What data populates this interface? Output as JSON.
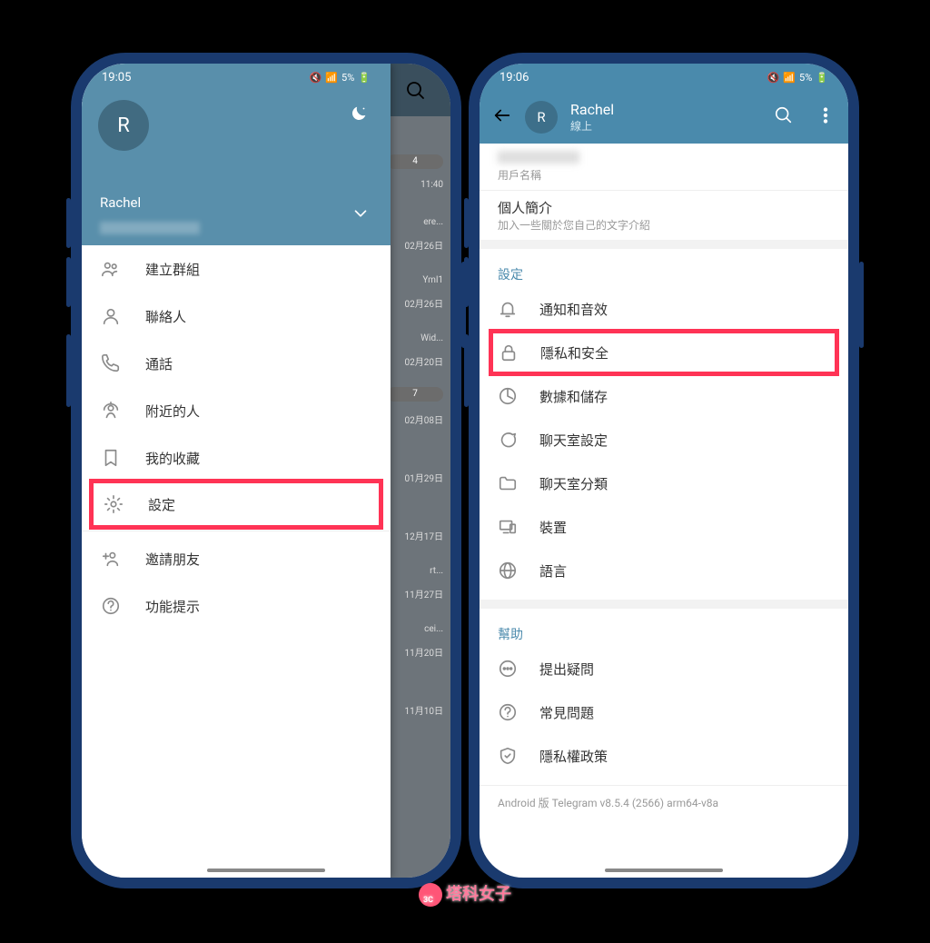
{
  "watermark": "塔科女子",
  "left": {
    "status_time": "19:05",
    "battery": "5%",
    "user_initial": "R",
    "user_name": "Rachel",
    "menu": {
      "new_group": "建立群組",
      "contacts": "聯絡人",
      "calls": "通話",
      "nearby": "附近的人",
      "saved": "我的收藏",
      "settings": "設定",
      "invite": "邀請朋友",
      "tips": "功能提示"
    },
    "chats": [
      {
        "badge": "4",
        "time": ""
      },
      {
        "time": "11:40",
        "text": "ere..."
      },
      {
        "time": "02月26日",
        "text": "Yml1"
      },
      {
        "time": "02月26日",
        "text": "Wid..."
      },
      {
        "time": "02月20日",
        "badge": "7"
      },
      {
        "time": "02月08日"
      },
      {
        "time": "01月29日"
      },
      {
        "time": "12月17日",
        "text": "rt..."
      },
      {
        "time": "11月27日",
        "text": "cei..."
      },
      {
        "time": "11月20日"
      },
      {
        "time": "11月10日"
      }
    ]
  },
  "right": {
    "status_time": "19:06",
    "battery": "5%",
    "user_initial": "R",
    "user_name": "Rachel",
    "user_status": "線上",
    "username_label": "用戶名稱",
    "bio_label": "個人簡介",
    "bio_hint": "加入一些關於您自己的文字介紹",
    "section_settings": "設定",
    "items": {
      "notifications": "通知和音效",
      "privacy": "隱私和安全",
      "data": "數據和儲存",
      "chat_settings": "聊天室設定",
      "chat_folders": "聊天室分類",
      "devices": "裝置",
      "language": "語言"
    },
    "section_help": "幫助",
    "help": {
      "ask": "提出疑問",
      "faq": "常見問題",
      "policy": "隱私權政策"
    },
    "version": "Android 版 Telegram v8.5.4 (2566) arm64-v8a"
  }
}
